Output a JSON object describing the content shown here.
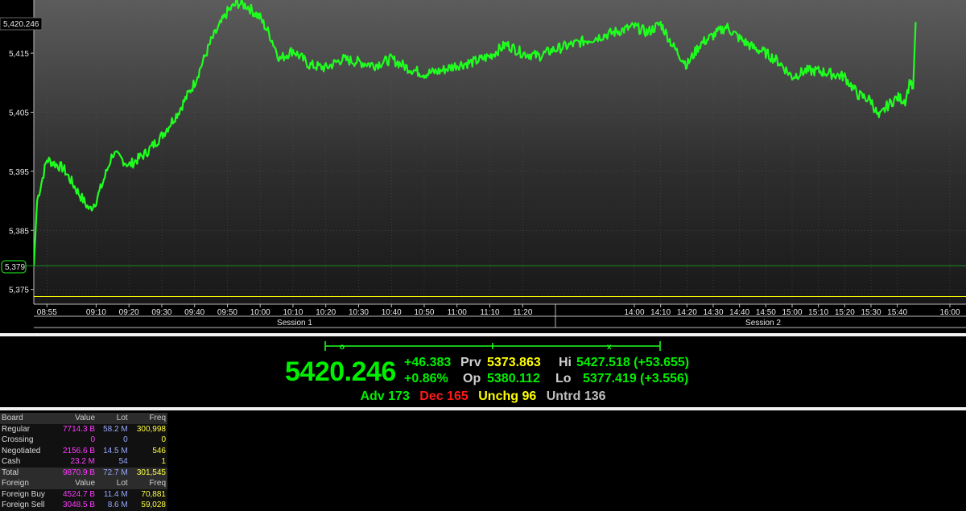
{
  "chart_data": {
    "type": "line",
    "series": [
      {
        "x": [
          "08:51",
          "08:52",
          "08:55",
          "09:00",
          "09:05",
          "09:08",
          "09:10",
          "09:12",
          "09:15",
          "09:18",
          "09:20",
          "09:25",
          "09:30",
          "09:35",
          "09:40",
          "09:45",
          "09:50",
          "09:53",
          "09:56",
          "10:00",
          "10:03",
          "10:06",
          "10:10",
          "10:15",
          "10:20",
          "10:25",
          "10:30",
          "10:35",
          "10:40",
          "10:45",
          "10:50",
          "10:55",
          "11:00",
          "11:05",
          "11:10",
          "11:15",
          "11:20",
          "11:25",
          "11:29",
          "14:00",
          "14:05",
          "14:10",
          "14:15",
          "14:20",
          "14:25",
          "14:30",
          "14:35",
          "14:40",
          "14:45",
          "14:50",
          "14:55",
          "15:00",
          "15:05",
          "15:10",
          "15:15",
          "15:20",
          "15:25",
          "15:30",
          "15:33",
          "15:36",
          "15:40",
          "15:43",
          "15:45",
          "15:46",
          "15:47"
        ],
        "y": [
          5379.0,
          5390.0,
          5397.0,
          5395.5,
          5391.0,
          5388.5,
          5390.0,
          5393.0,
          5398.0,
          5397.0,
          5396.0,
          5398.0,
          5401.0,
          5405.0,
          5410.0,
          5417.0,
          5422.0,
          5423.5,
          5423.0,
          5421.0,
          5418.0,
          5414.0,
          5415.5,
          5413.0,
          5412.5,
          5414.0,
          5413.5,
          5413.0,
          5414.0,
          5412.5,
          5411.5,
          5412.0,
          5413.0,
          5413.5,
          5414.5,
          5416.5,
          5415.0,
          5414.5,
          5415.5,
          5419.5,
          5418.5,
          5420.0,
          5416.0,
          5413.0,
          5416.5,
          5418.0,
          5419.5,
          5417.5,
          5416.0,
          5415.0,
          5413.5,
          5411.0,
          5412.0,
          5412.0,
          5411.5,
          5411.0,
          5408.0,
          5407.0,
          5404.0,
          5406.0,
          5407.5,
          5407.0,
          5410.5,
          5409.0,
          5420.246
        ]
      }
    ],
    "ylim": [
      5372.5,
      5424.0
    ],
    "y_ticks": [
      "5,375",
      "5,385",
      "5,395",
      "5,405",
      "5,415"
    ],
    "x_ticks": [
      "08:55",
      "09:10",
      "09:20",
      "09:30",
      "09:40",
      "09:50",
      "10:00",
      "10:10",
      "10:20",
      "10:30",
      "10:40",
      "10:50",
      "11:00",
      "11:10",
      "11:20",
      "14:00",
      "14:10",
      "14:20",
      "14:30",
      "14:40",
      "14:50",
      "15:00",
      "15:10",
      "15:20",
      "15:30",
      "15:40",
      "16:00"
    ],
    "last_value_label": "5,420.246",
    "prev_close_label": "5,379",
    "prev_close_value": 5379.0,
    "yellow_line_value": 5373.8,
    "sessions": [
      "Session 1",
      "Session 2"
    ],
    "grid": true,
    "colors": {
      "line": "#1fff1f",
      "yellow_line": "#ffff00",
      "prev_line": "#1f8c1f",
      "grid": "#555555"
    }
  },
  "quote": {
    "last": "5420.246",
    "change": "+46.383",
    "change_pct": "+0.86%",
    "prv_label": "Prv",
    "prv": "5373.863",
    "op_label": "Op",
    "op": "5380.112",
    "hi_label": "Hi",
    "hi": "5427.518 (+53.655)",
    "lo_label": "Lo",
    "lo": "5377.419 (+3.556)"
  },
  "breadth": {
    "adv": "Adv 173",
    "dec": "Dec 165",
    "unchg": "Unchg 96",
    "untrd": "Untrd 136"
  },
  "board": {
    "headers": [
      "Board",
      "Value",
      "Lot",
      "Freq"
    ],
    "rows": [
      [
        "Regular",
        "7714.3 B",
        "58.2 M",
        "300,998"
      ],
      [
        "Crossing",
        "0",
        "0",
        "0"
      ],
      [
        "Negotiated",
        "2156.6 B",
        "14.5 M",
        "546"
      ],
      [
        "Cash",
        "23.2 M",
        "54",
        "1"
      ],
      [
        "Total",
        "9870.9 B",
        "72.7 M",
        "301,545"
      ]
    ],
    "foreign_headers": [
      "Foreign",
      "Value",
      "Lot",
      "Freq"
    ],
    "foreign_rows": [
      [
        "Foreign Buy",
        "4524.7 B",
        "11.4 M",
        "70,881"
      ],
      [
        "Foreign Sell",
        "3048.5 B",
        "8.6 M",
        "59,028"
      ]
    ]
  }
}
